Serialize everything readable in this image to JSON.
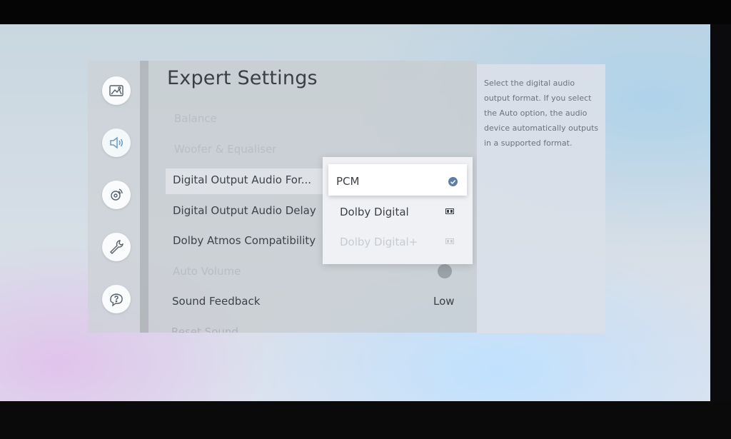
{
  "title": "Expert Settings",
  "menu": {
    "balance": "Balance",
    "woofer": "Woofer & Equaliser",
    "digital_format": "Digital Output Audio For...",
    "digital_delay": "Digital Output Audio Delay",
    "atmos": "Dolby Atmos Compatibility",
    "auto_volume": "Auto Volume",
    "sound_feedback": "Sound Feedback",
    "sound_feedback_value": "Low",
    "reset_sound": "Reset Sound"
  },
  "dropdown": {
    "options": [
      "PCM",
      "Dolby Digital",
      "Dolby Digital+"
    ],
    "selected": "PCM"
  },
  "description": "Select the digital audio output format. If you select the Auto option, the audio device automatically outputs in a supported format.",
  "colors": {
    "accent": "#5f7ea6",
    "panel": "#c8cdd1",
    "text": "#3d4248"
  },
  "icons": {
    "rail": [
      "picture-icon",
      "sound-icon",
      "broadcast-icon",
      "support-icon",
      "help-icon"
    ],
    "selected_option": "check-icon",
    "dolby": "dolby-icon"
  }
}
